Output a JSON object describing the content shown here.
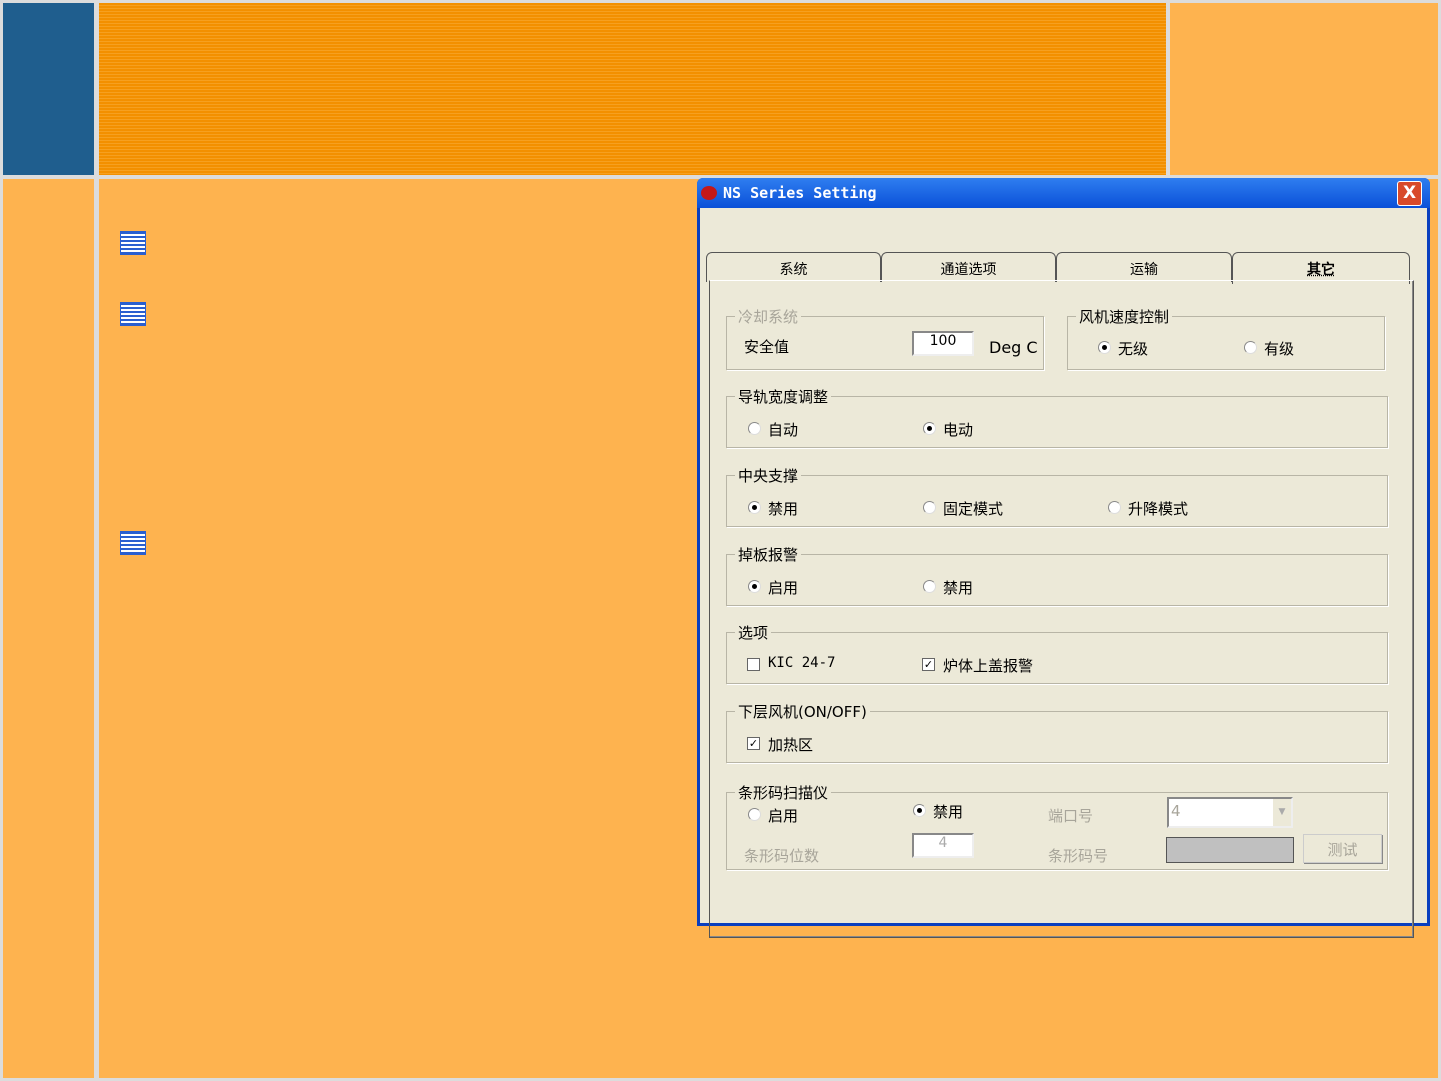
{
  "dialog": {
    "title": "NS Series Setting",
    "close": "X",
    "tabs": [
      "系统",
      "通道选项",
      "运输",
      "其它"
    ],
    "cooling": {
      "label": "冷却系统",
      "safe_label": "安全值",
      "safe_value": "100",
      "unit": "Deg C"
    },
    "fan_speed": {
      "label": "风机速度控制",
      "options": [
        "无级",
        "有级"
      ],
      "selected": "无级"
    },
    "rail": {
      "label": "导轨宽度调整",
      "options": [
        "自动",
        "电动"
      ],
      "selected": "电动"
    },
    "center_support": {
      "label": "中央支撑",
      "options": [
        "禁用",
        "固定模式",
        "升降模式"
      ],
      "selected": "禁用"
    },
    "board_drop": {
      "label": "掉板报警",
      "options": [
        "启用",
        "禁用"
      ],
      "selected": "启用"
    },
    "options": {
      "label": "选项",
      "items": [
        {
          "label": "KIC 24-7",
          "checked": false
        },
        {
          "label": "炉体上盖报警",
          "checked": true
        }
      ]
    },
    "lower_fan": {
      "label": "下层风机(ON/OFF)",
      "items": [
        {
          "label": "加热区",
          "checked": true
        }
      ]
    },
    "barcode": {
      "label": "条形码扫描仪",
      "options": [
        "启用",
        "禁用"
      ],
      "selected": "禁用",
      "port_label": "端口号",
      "port_value": "4",
      "digits_label": "条形码位数",
      "digits_value": "4",
      "code_label": "条形码号",
      "test": "测试"
    }
  }
}
